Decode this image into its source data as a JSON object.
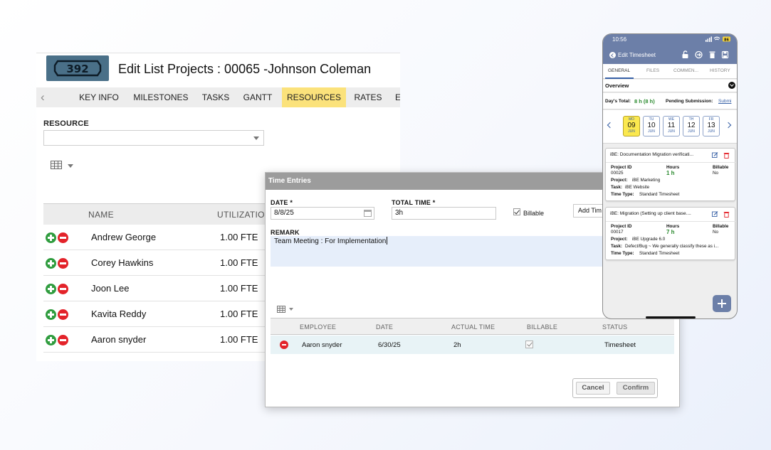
{
  "app": {
    "logo_text": "392",
    "title": "Edit List Projects : 00065 -Johnson Coleman",
    "tabs": [
      "KEY INFO",
      "MILESTONES",
      "TASKS",
      "GANTT",
      "RESOURCES",
      "RATES",
      "E"
    ],
    "active_tab": "RESOURCES",
    "resource_label": "RESOURCE",
    "resource_value": "",
    "columns": [
      "NAME",
      "UTILIZATIO"
    ],
    "rows": [
      {
        "name": "Andrew George",
        "fte": "1.00 FTE"
      },
      {
        "name": "Corey Hawkins",
        "fte": "1.00 FTE"
      },
      {
        "name": "Joon Lee",
        "fte": "1.00 FTE"
      },
      {
        "name": "Kavita Reddy",
        "fte": "1.00 FTE"
      },
      {
        "name": "Aaron snyder",
        "fte": "1.00 FTE"
      }
    ]
  },
  "dialog": {
    "title": "Time Entries",
    "date_label": "DATE *",
    "date_value": "8/8/25",
    "total_label": "TOTAL TIME *",
    "total_value": "3h",
    "billable_label": "Billable",
    "billable_checked": true,
    "add_time_label": "Add Tim",
    "remark_label": "REMARK",
    "remark_value": "Team Meeting : For Implementation",
    "columns": [
      "EMPLOYEE",
      "DATE",
      "ACTUAL TIME",
      "BILLABLE",
      "STATUS"
    ],
    "rows": [
      {
        "employee": "Aaron snyder",
        "date": "6/30/25",
        "actual_time": "2h",
        "billable": true,
        "status": "Timesheet"
      }
    ],
    "cancel_label": "Cancel",
    "confirm_label": "Confirm"
  },
  "phone": {
    "time": "10:56",
    "battery": "86",
    "title": "Edit Timesheet",
    "tabs": [
      "GENERAL",
      "FILES",
      "COMMEN...",
      "HISTORY"
    ],
    "active_tab": "GENERAL",
    "overview_label": "Overview",
    "days_total_label": "Day's Total:",
    "days_total_value": "8 h (8 h)",
    "pending_label": "Pending Submission:",
    "pending_link": "Submi",
    "days": [
      {
        "name": "MO",
        "num": "09",
        "month": "JUN",
        "selected": true
      },
      {
        "name": "TU",
        "num": "10",
        "month": "JUN",
        "selected": false
      },
      {
        "name": "WE",
        "num": "11",
        "month": "JUN",
        "selected": false
      },
      {
        "name": "TH",
        "num": "12",
        "month": "JUN",
        "selected": false
      },
      {
        "name": "FR",
        "num": "13",
        "month": "JUN",
        "selected": false
      }
    ],
    "labels": {
      "project_id": "Project ID",
      "hours": "Hours",
      "billable": "Billable",
      "project": "Project:",
      "task": "Task:",
      "time_type": "Time Type:"
    },
    "cards": [
      {
        "title": "iBE: Documentation Migration verificati...",
        "project_id": "00025",
        "hours": "1 h",
        "billable": "No",
        "project": "iBE Marketing",
        "task": "iBE Website",
        "time_type": "Standard Timesheet"
      },
      {
        "title": "iBE: Migration (Setting up client base....",
        "project_id": "00017",
        "hours": "7 h",
        "billable": "No",
        "project": "iBE Upgrade 6.0",
        "task": "Defect/Bug ~ We generally classify these as i...",
        "time_type": "Standard Timesheet"
      }
    ],
    "colors": {
      "header": "#6c7fa8",
      "selected_day": "#fbe84e",
      "hours": "#2a8a2e"
    }
  },
  "colors": {
    "active_tab": "#fbe27b",
    "add_icon": "#2f9c3e",
    "remove_icon": "#e3232a",
    "dialog_header": "#9c9c9c"
  }
}
